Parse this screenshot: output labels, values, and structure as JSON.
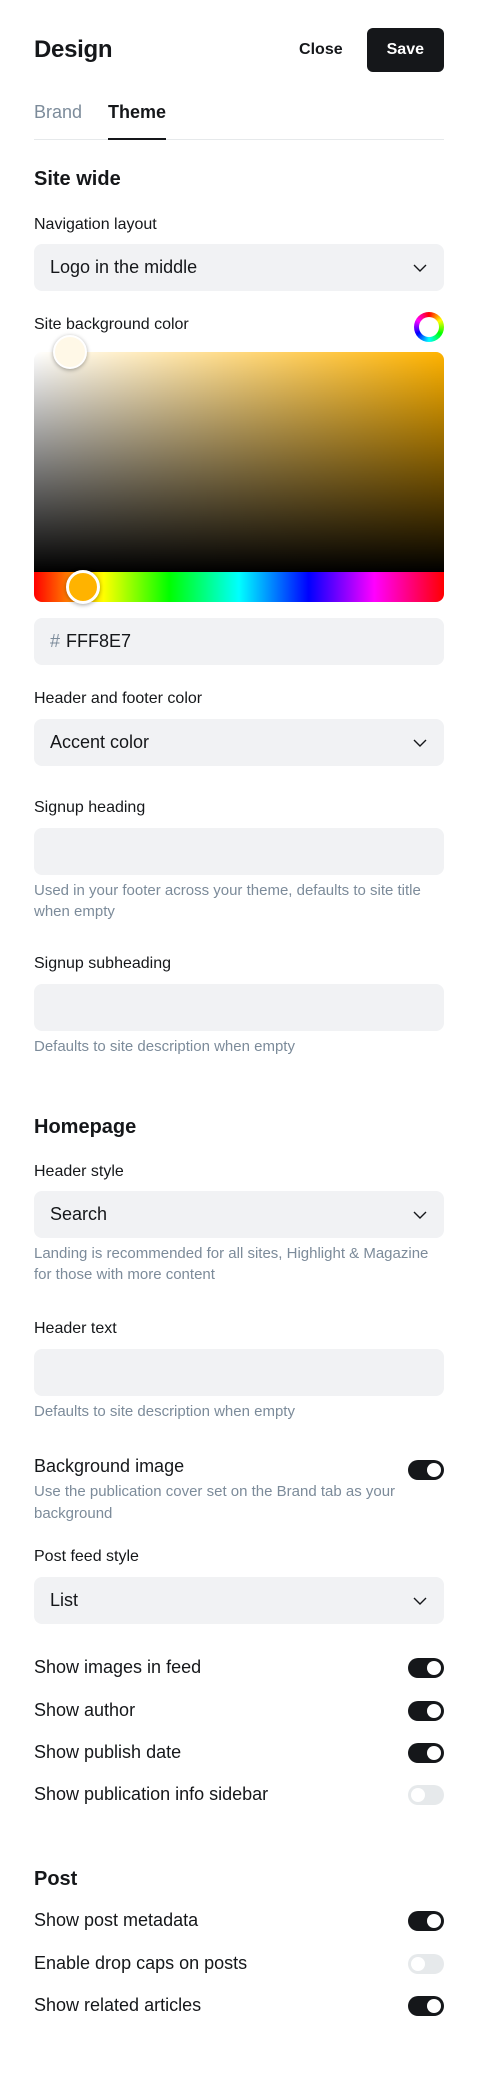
{
  "header": {
    "title": "Design",
    "close_label": "Close",
    "save_label": "Save"
  },
  "tabs": [
    {
      "label": "Brand",
      "active": false
    },
    {
      "label": "Theme",
      "active": true
    }
  ],
  "site_wide": {
    "title": "Site wide",
    "navigation_layout": {
      "label": "Navigation layout",
      "value": "Logo in the middle"
    },
    "background_color": {
      "label": "Site background color",
      "hash": "#",
      "hex": "FFF8E7",
      "hue_color": "#ffb300"
    },
    "header_footer_color": {
      "label": "Header and footer color",
      "value": "Accent color"
    },
    "signup_heading": {
      "label": "Signup heading",
      "value": "",
      "hint": "Used in your footer across your theme, defaults to site title when empty"
    },
    "signup_subheading": {
      "label": "Signup subheading",
      "value": "",
      "hint": "Defaults to site description when empty"
    }
  },
  "homepage": {
    "title": "Homepage",
    "header_style": {
      "label": "Header style",
      "value": "Search",
      "hint": "Landing is recommended for all sites, Highlight & Magazine for those with more content"
    },
    "header_text": {
      "label": "Header text",
      "value": "",
      "hint": "Defaults to site description when empty"
    },
    "background_image": {
      "label": "Background image",
      "desc": "Use the publication cover set on the Brand tab as your background",
      "on": true
    },
    "post_feed_style": {
      "label": "Post feed style",
      "value": "List"
    },
    "toggles": [
      {
        "label": "Show images in feed",
        "on": true
      },
      {
        "label": "Show author",
        "on": true
      },
      {
        "label": "Show publish date",
        "on": true
      },
      {
        "label": "Show publication info sidebar",
        "on": false
      }
    ]
  },
  "post": {
    "title": "Post",
    "toggles": [
      {
        "label": "Show post metadata",
        "on": true
      },
      {
        "label": "Enable drop caps on posts",
        "on": false
      },
      {
        "label": "Show related articles",
        "on": true
      }
    ]
  },
  "icons": {
    "select": "chevron-down-icon",
    "color_swatch": "color-wheel-icon"
  }
}
